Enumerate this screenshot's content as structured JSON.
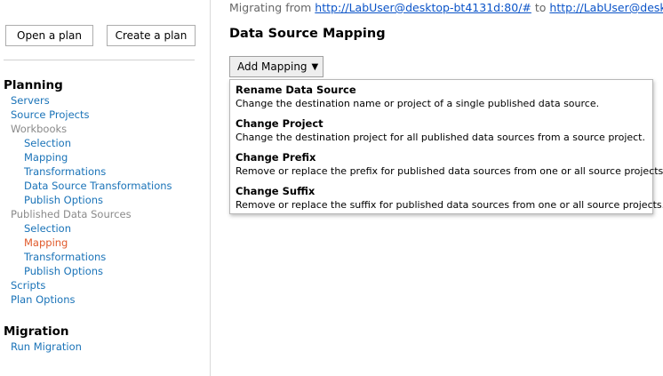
{
  "header": {
    "migrating_prefix": "Migrating from",
    "source_url": "http://LabUser@desktop-bt4131d:80/#",
    "connector": "to",
    "destination_url": "http://LabUser@desktop-b"
  },
  "toolbar": {
    "open_plan_label": "Open a plan",
    "create_plan_label": "Create a plan"
  },
  "sidebar": {
    "planning_title": "Planning",
    "planning_items": {
      "servers": "Servers",
      "source_projects": "Source Projects",
      "workbooks": "Workbooks",
      "wb_selection": "Selection",
      "wb_mapping": "Mapping",
      "wb_transformations": "Transformations",
      "wb_ds_transformations": "Data Source Transformations",
      "wb_publish_options": "Publish Options",
      "published_data_sources": "Published Data Sources",
      "pds_selection": "Selection",
      "pds_mapping": "Mapping",
      "pds_transformations": "Transformations",
      "pds_publish_options": "Publish Options",
      "scripts": "Scripts",
      "plan_options": "Plan Options"
    },
    "migration_title": "Migration",
    "migration_items": {
      "run_migration": "Run Migration"
    }
  },
  "main": {
    "title": "Data Source Mapping",
    "add_mapping_label": "Add Mapping",
    "add_mapping_icon": "caret-down-icon",
    "menu": [
      {
        "title": "Rename Data Source",
        "description": "Change the destination name or project of a single published data source."
      },
      {
        "title": "Change Project",
        "description": "Change the destination project for all published data sources from a source project."
      },
      {
        "title": "Change Prefix",
        "description": "Remove or replace the prefix for published data sources from one or all source projects."
      },
      {
        "title": "Change Suffix",
        "description": "Remove or replace the suffix for published data sources from one or all source projects."
      }
    ]
  },
  "colors": {
    "link": "#1a73b8",
    "active": "#e05a2b",
    "group": "#8a8a8a"
  }
}
